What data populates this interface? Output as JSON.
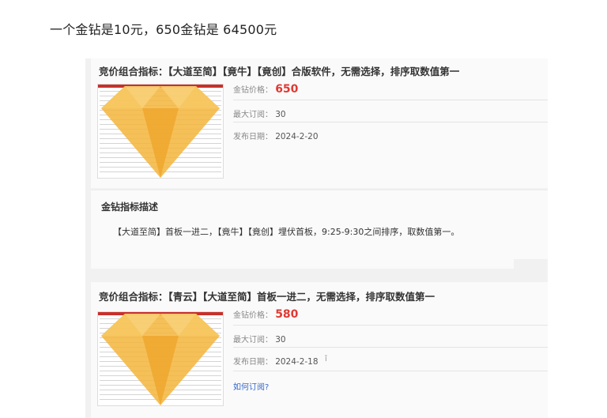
{
  "headline": "一个金钻是10元，650金钻是 64500元",
  "cards": [
    {
      "title": "竞价组合指标：【大道至简】【竟牛】【竟创】合版软件，无需选择，排序取数值第一",
      "price_label": "金钻价格：",
      "price": "650",
      "max_sub_label": "最大订阅：",
      "max_sub": "30",
      "date_label": "发布日期：",
      "date": "2024-2-20"
    },
    {
      "title": "竞价组合指标：【青云】【大道至简】首板一进二，无需选择，排序取数值第一",
      "price_label": "金钻价格：",
      "price": "580",
      "max_sub_label": "最大订阅：",
      "max_sub": "30",
      "date_label": "发布日期：",
      "date": "2024-2-18",
      "mark": "ǐ",
      "link": "如何订阅?"
    }
  ],
  "description": {
    "title": "金钻指标描述",
    "text": "【大道至简】首板一进二，【竟牛】【竟创】埋伏首板，9:25-9:30之间排序，取数值第一。"
  },
  "colors": {
    "price": "#e03a33",
    "diamond": "#f5b53c",
    "link": "#3366cc"
  }
}
